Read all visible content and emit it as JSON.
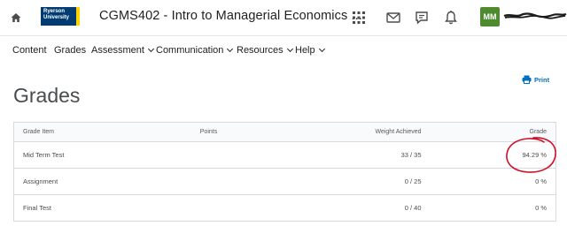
{
  "header": {
    "logo_line1": "Ryerson",
    "logo_line2": "University",
    "course_title": "CGMS402 - Intro to Managerial Economics ...",
    "user_initials": "MM"
  },
  "nav": {
    "items": [
      {
        "label": "Content",
        "dropdown": false
      },
      {
        "label": "Grades",
        "dropdown": false
      },
      {
        "label": "Assessment",
        "dropdown": true
      },
      {
        "label": "Communication",
        "dropdown": true
      },
      {
        "label": "Resources",
        "dropdown": true
      },
      {
        "label": "Help",
        "dropdown": true
      }
    ]
  },
  "page": {
    "title": "Grades",
    "print_label": "Print"
  },
  "table": {
    "headers": [
      "Grade Item",
      "Points",
      "Weight Achieved",
      "Grade"
    ],
    "rows": [
      {
        "item": "Mid Term Test",
        "points": "",
        "weight": "33 / 35",
        "grade": "94.29 %"
      },
      {
        "item": "Assignment",
        "points": "",
        "weight": "0 / 25",
        "grade": "0 %"
      },
      {
        "item": "Final Test",
        "points": "",
        "weight": "0 / 40",
        "grade": "0 %"
      }
    ]
  },
  "colors": {
    "logo_blue": "#003c71",
    "logo_gold": "#ffd200",
    "avatar_green": "#4e8a2f",
    "link_blue": "#006fbf",
    "annotation_red": "#d0102a"
  },
  "icons": [
    "home-icon",
    "apps-grid-icon",
    "mail-icon",
    "chat-icon",
    "bell-icon",
    "printer-icon"
  ]
}
